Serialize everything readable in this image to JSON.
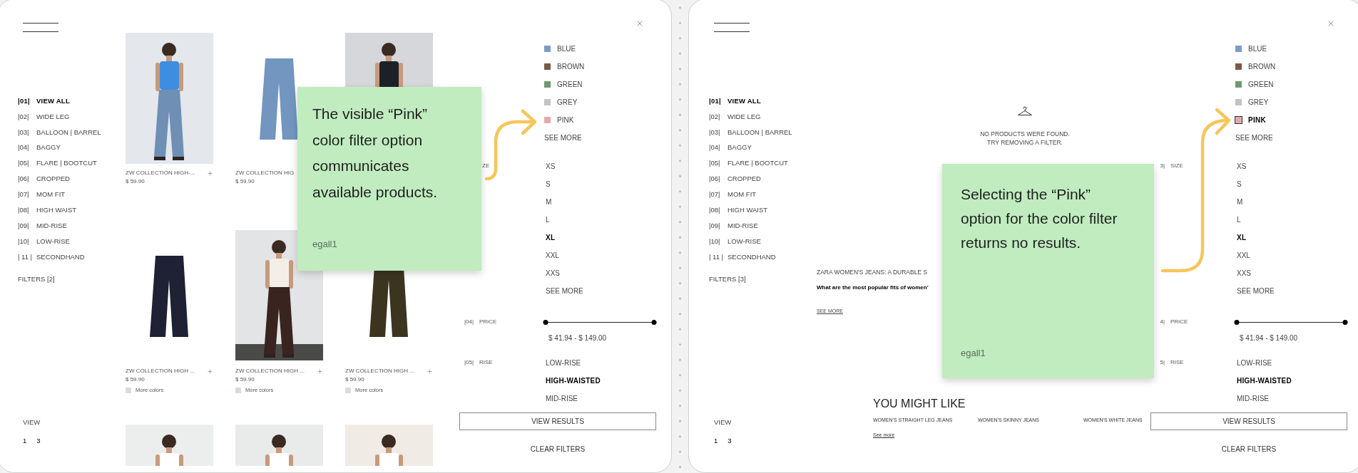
{
  "frames": [
    {
      "nav": {
        "categories": [
          {
            "number": "|01|",
            "label": "VIEW ALL",
            "selected": true
          },
          {
            "number": "|02|",
            "label": "WIDE LEG",
            "selected": false
          },
          {
            "number": "|03|",
            "label": "BALLOON | BARREL",
            "selected": false
          },
          {
            "number": "|04|",
            "label": "BAGGY",
            "selected": false
          },
          {
            "number": "|05|",
            "label": "FLARE | BOOTCUT",
            "selected": false
          },
          {
            "number": "|06|",
            "label": "CROPPED",
            "selected": false
          },
          {
            "number": "|07|",
            "label": "MOM FIT",
            "selected": false
          },
          {
            "number": "|08|",
            "label": "HIGH WAIST",
            "selected": false
          },
          {
            "number": "|09|",
            "label": "MID-RISE",
            "selected": false
          },
          {
            "number": "|10|",
            "label": "LOW-RISE",
            "selected": false
          },
          {
            "number": "| 11 |",
            "label": "SECONDHAND",
            "selected": false
          }
        ],
        "filters": "FILTERS [2]",
        "view_label": "VIEW",
        "view_options": [
          "1",
          "3"
        ]
      },
      "main": {
        "kind": "products",
        "products": [
          {
            "kind": "captioned",
            "name": "ZW COLLECTION HIGH-...",
            "price": "$ 59.90",
            "add": true
          },
          {
            "kind": "captioned",
            "name": "ZW COLLECTION HIG",
            "price": "$ 59.90",
            "add": false
          },
          {
            "kind": "picture"
          },
          {
            "kind": "captioned",
            "name": "ZW COLLECTION HIGH ...",
            "price": "$ 59.90",
            "add": true,
            "more_colors": "More colors"
          },
          {
            "kind": "captioned",
            "name": "ZW COLLECTION HIGH ...",
            "price": "$ 59.90",
            "add": true,
            "more_colors": "More colors"
          },
          {
            "kind": "captioned",
            "name": "ZW COLLECTION HIGH ...",
            "price": "$ 59.90",
            "add": true,
            "more_colors": "More colors"
          },
          {
            "kind": "picture"
          },
          {
            "kind": "picture"
          },
          {
            "kind": "picture"
          }
        ]
      },
      "filters": {
        "colors": [
          {
            "label": "BLUE",
            "color": "#7b9cc7",
            "selected": false
          },
          {
            "label": "BROWN",
            "color": "#7a5a43",
            "selected": false
          },
          {
            "label": "GREEN",
            "color": "#6f9a6e",
            "selected": false
          },
          {
            "label": "GREY",
            "color": "#c3c3c3",
            "selected": false
          },
          {
            "label": "PINK",
            "color": "#e3a9aa",
            "selected": false
          }
        ],
        "colors_more": "SEE MORE",
        "size_label": {
          "name": "ZE"
        },
        "sizes": [
          {
            "label": "XS",
            "selected": false
          },
          {
            "label": "S",
            "selected": false
          },
          {
            "label": "M",
            "selected": false
          },
          {
            "label": "L",
            "selected": false
          },
          {
            "label": "XL",
            "selected": true
          },
          {
            "label": "XXL",
            "selected": false
          },
          {
            "label": "XXS",
            "selected": false
          }
        ],
        "sizes_more": "SEE MORE",
        "price_label": {
          "number": "|04|",
          "name": "PRICE"
        },
        "price_thumbs": [
          {
            "level": 0
          },
          {
            "level": 1
          }
        ],
        "price_text": "$ 41.94 - $ 149.00",
        "rise_label": {
          "number": "|05|",
          "name": "RISE"
        },
        "rise": [
          {
            "label": "LOW-RISE",
            "selected": false
          },
          {
            "label": "HIGH-WAISTED",
            "selected": true
          },
          {
            "label": "MID-RISE",
            "selected": false
          }
        ],
        "view_results": "VIEW RESULTS",
        "clear": "CLEAR FILTERS"
      },
      "note": {
        "text": "The visible “Pink” color filter option communicates available products.",
        "author": "egall1"
      }
    },
    {
      "nav": {
        "categories": [
          {
            "number": "|01|",
            "label": "VIEW ALL",
            "selected": true
          },
          {
            "number": "|02|",
            "label": "WIDE LEG",
            "selected": false
          },
          {
            "number": "|03|",
            "label": "BALLOON | BARREL",
            "selected": false
          },
          {
            "number": "|04|",
            "label": "BAGGY",
            "selected": false
          },
          {
            "number": "|05|",
            "label": "FLARE | BOOTCUT",
            "selected": false
          },
          {
            "number": "|06|",
            "label": "CROPPED",
            "selected": false
          },
          {
            "number": "|07|",
            "label": "MOM FIT",
            "selected": false
          },
          {
            "number": "|08|",
            "label": "HIGH WAIST",
            "selected": false
          },
          {
            "number": "|09|",
            "label": "MID-RISE",
            "selected": false
          },
          {
            "number": "|10|",
            "label": "LOW-RISE",
            "selected": false
          },
          {
            "number": "| 11 |",
            "label": "SECONDHAND",
            "selected": false
          }
        ],
        "filters": "FILTERS [3]",
        "view_label": "VIEW",
        "view_options": [
          "1",
          "3"
        ]
      },
      "main": {
        "kind": "empty",
        "message": [
          "NO PRODUCTS WERE FOUND.",
          "TRY REMOVING A FILTER."
        ],
        "seo_title": "ZARA WOMEN'S JEANS: A DURABLE S",
        "seo_question": "What are the most popular fits of women'",
        "seo_more": "SEE MORE",
        "recommendations": {
          "title": "YOU MIGHT LIKE",
          "links": [
            "WOMEN'S STRAIGHT LEG JEANS",
            "WOMEN'S SKINNY JEANS",
            "WOMEN'S WHITE JEANS"
          ],
          "more": "See more"
        }
      },
      "filters": {
        "colors": [
          {
            "label": "BLUE",
            "color": "#7b9cc7",
            "selected": false
          },
          {
            "label": "BROWN",
            "color": "#7a5a43",
            "selected": false
          },
          {
            "label": "GREEN",
            "color": "#6f9a6e",
            "selected": false
          },
          {
            "label": "GREY",
            "color": "#c3c3c3",
            "selected": false
          },
          {
            "label": "PINK",
            "color": "#e3a9aa",
            "selected": true
          }
        ],
        "colors_more": "SEE MORE",
        "size_label": {
          "number": "3|",
          "name": "SIZE"
        },
        "sizes": [
          {
            "label": "XS",
            "selected": false
          },
          {
            "label": "S",
            "selected": false
          },
          {
            "label": "M",
            "selected": false
          },
          {
            "label": "L",
            "selected": false
          },
          {
            "label": "XL",
            "selected": true
          },
          {
            "label": "XXL",
            "selected": false
          },
          {
            "label": "XXS",
            "selected": false
          }
        ],
        "sizes_more": "SEE MORE",
        "price_label": {
          "number": "4|",
          "name": "PRICE"
        },
        "price_thumbs": [
          {
            "level": 0
          },
          {
            "level": 1
          }
        ],
        "price_text": "$ 41.94 - $ 149.00",
        "rise_label": {
          "number": "5|",
          "name": "RISE"
        },
        "rise": [
          {
            "label": "LOW-RISE",
            "selected": false
          },
          {
            "label": "HIGH-WAISTED",
            "selected": true
          },
          {
            "label": "MID-RISE",
            "selected": false
          }
        ],
        "view_results": "VIEW RESULTS",
        "clear": "CLEAR FILTERS"
      },
      "note": {
        "text": "Selecting the “Pink” option for the color filter returns no results.",
        "author": "egall1"
      }
    }
  ]
}
